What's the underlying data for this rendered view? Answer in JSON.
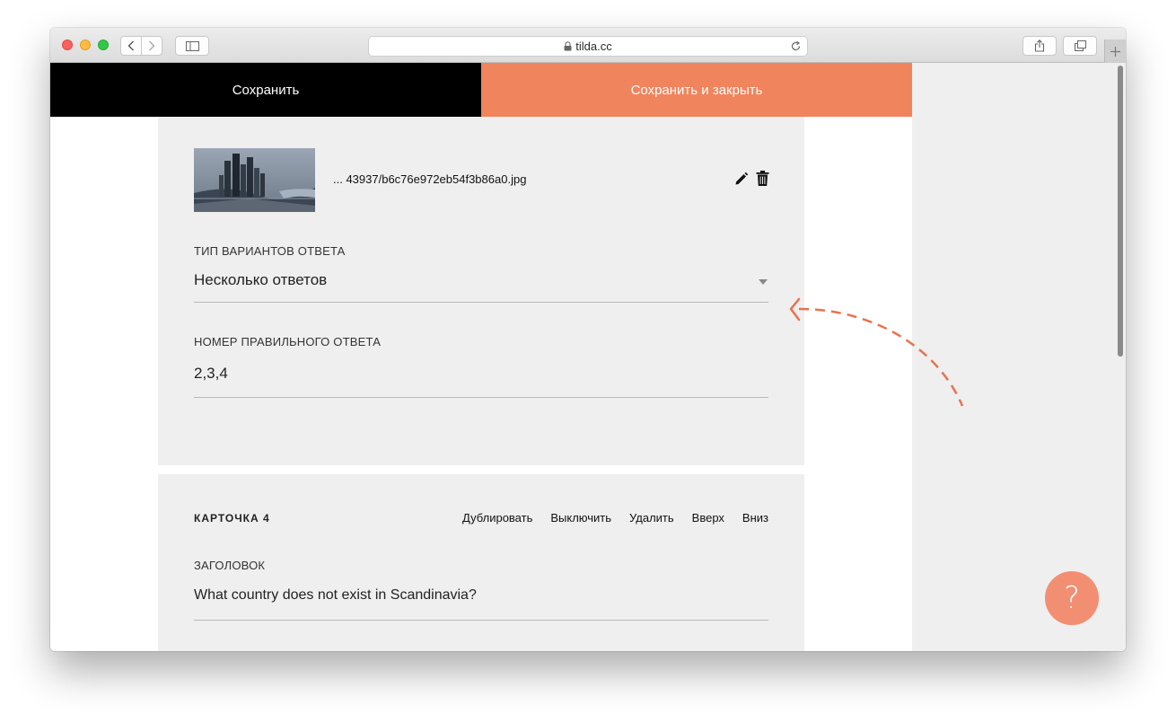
{
  "browser": {
    "url": "tilda.cc"
  },
  "toolbar": {
    "save_label": "Сохранить",
    "save_close_label": "Сохранить и закрыть"
  },
  "card3": {
    "image_filename": "... 43937/b6c76e972eb54f3b86a0.jpg",
    "answer_type_label": "ТИП ВАРИАНТОВ ОТВЕТА",
    "answer_type_value": "Несколько ответов",
    "correct_answer_label": "НОМЕР ПРАВИЛЬНОГО ОТВЕТА",
    "correct_answer_value": "2,3,4"
  },
  "card4": {
    "title": "КАРТОЧКА 4",
    "actions": [
      "Дублировать",
      "Выключить",
      "Удалить",
      "Вверх",
      "Вниз"
    ],
    "heading_label": "ЗАГОЛОВОК",
    "heading_value": "What country does not exist in Scandinavia?"
  },
  "help": {
    "label": "?"
  },
  "colors": {
    "accent": "#f0845d",
    "help_button": "#f28f73",
    "annotation_arrow": "#e8734d"
  }
}
